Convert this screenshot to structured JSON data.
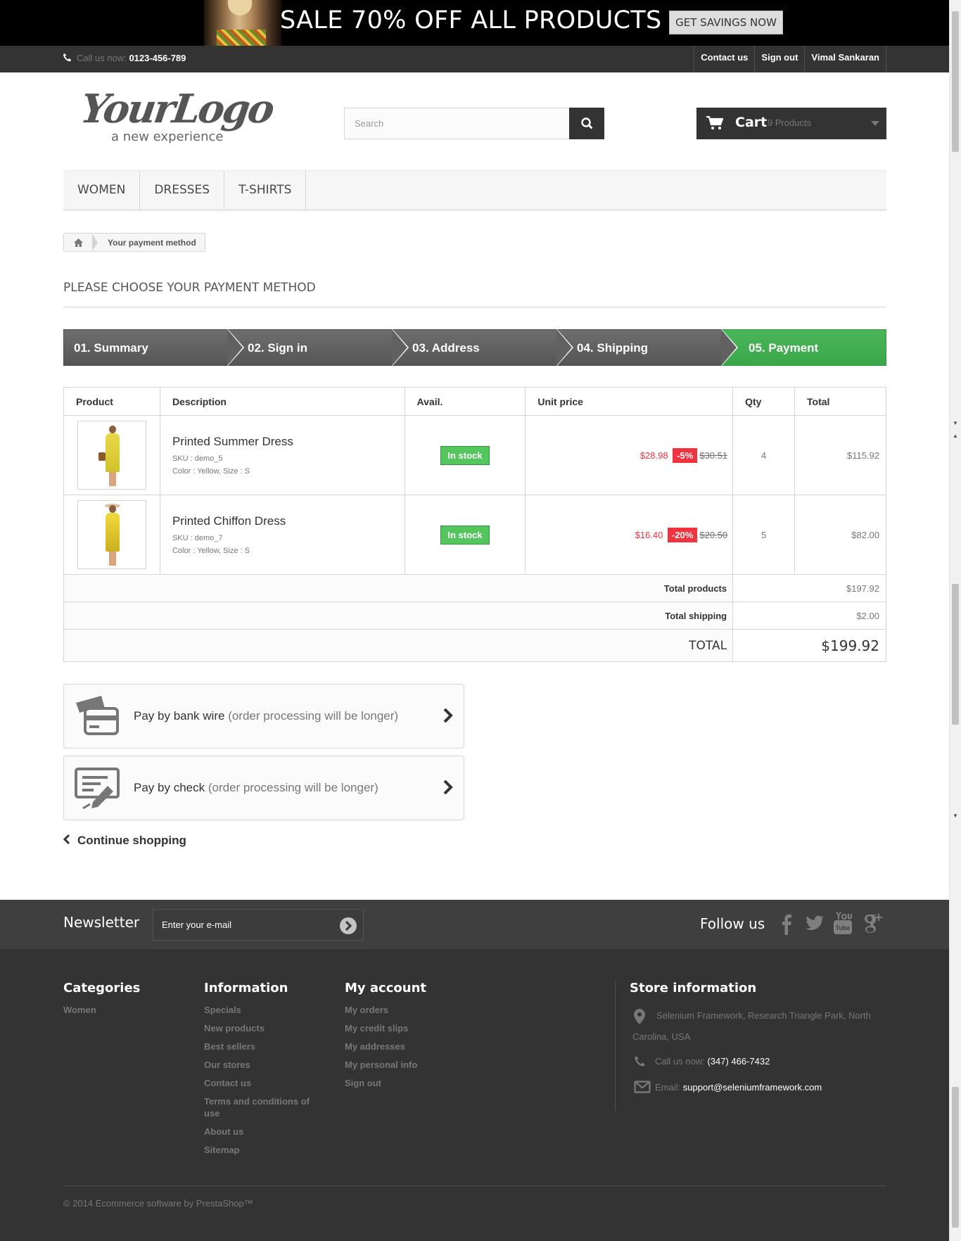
{
  "banner": {
    "title": "SALE 70% OFF ALL PRODUCTS",
    "cta": "GET SAVINGS NOW"
  },
  "topbar": {
    "call_label": "Call us now:",
    "phone": "0123-456-789",
    "links": [
      "Contact us",
      "Sign out",
      "Vimal Sankaran"
    ]
  },
  "header": {
    "logo_script": "YourLogo",
    "logo_tagline": "a new experience",
    "search_placeholder": "Search",
    "cart_label": "Cart",
    "cart_count": "9 Products"
  },
  "menu": [
    "WOMEN",
    "DRESSES",
    "T-SHIRTS"
  ],
  "breadcrumb": {
    "current": "Your payment method"
  },
  "page_title": "PLEASE CHOOSE YOUR PAYMENT METHOD",
  "steps": [
    "01. Summary",
    "02. Sign in",
    "03. Address",
    "04. Shipping",
    "05. Payment"
  ],
  "active_step": "05. Payment",
  "table": {
    "headers": [
      "Product",
      "Description",
      "Avail.",
      "Unit price",
      "Qty",
      "Total"
    ],
    "rows": [
      {
        "name": "Printed Summer Dress",
        "sku": "SKU : demo_5",
        "attrs": "Color : Yellow, Size : S",
        "avail": "In stock",
        "price": "$28.98",
        "reduction": "-5%",
        "old_price": "$30.51",
        "qty": "4",
        "total": "$115.92"
      },
      {
        "name": "Printed Chiffon Dress",
        "sku": "SKU : demo_7",
        "attrs": "Color : Yellow, Size : S",
        "avail": "In stock",
        "price": "$16.40",
        "reduction": "-20%",
        "old_price": "$20.50",
        "qty": "5",
        "total": "$82.00"
      }
    ],
    "total_products_label": "Total products",
    "total_products": "$197.92",
    "total_shipping_label": "Total shipping",
    "total_shipping": "$2.00",
    "total_label": "TOTAL",
    "total": "$199.92"
  },
  "payment": {
    "bankwire": {
      "strong": "Pay by bank wire",
      "note": "(order processing will be longer)"
    },
    "check": {
      "strong": "Pay by check",
      "note": "(order processing will be longer)"
    }
  },
  "continue_shopping": "Continue shopping",
  "newsletter": {
    "title": "Newsletter",
    "placeholder": "Enter your e-mail",
    "follow": "Follow us"
  },
  "footer": {
    "categories": {
      "title": "Categories",
      "items": [
        "Women"
      ]
    },
    "information": {
      "title": "Information",
      "items": [
        "Specials",
        "New products",
        "Best sellers",
        "Our stores",
        "Contact us",
        "Terms and conditions of use",
        "About us",
        "Sitemap"
      ]
    },
    "account": {
      "title": "My account",
      "items": [
        "My orders",
        "My credit slips",
        "My addresses",
        "My personal info",
        "Sign out"
      ]
    },
    "store": {
      "title": "Store information",
      "address": "Selenium Framework, Research Triangle Park, North Carolina, USA",
      "call_label": "Call us now:",
      "phone": "(347) 466-7432",
      "email_label": "Email:",
      "email": "support@seleniumframework.com"
    },
    "copyright": "© 2014 Ecommerce software by PrestaShop™"
  },
  "colors": {
    "accent_green": "#46b856",
    "price_red": "#f13340",
    "dark": "#333333"
  }
}
